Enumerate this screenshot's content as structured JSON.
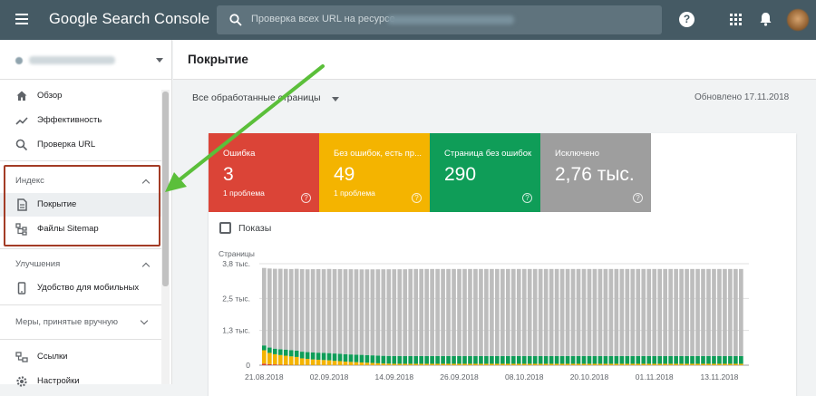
{
  "header": {
    "app_title": "Google Search Console",
    "search_placeholder": "Проверка всех URL на ресурсе",
    "help_glyph": "?"
  },
  "sidebar": {
    "items": [
      {
        "label": "Обзор",
        "icon": "home-icon"
      },
      {
        "label": "Эффективность",
        "icon": "trending-up-icon"
      },
      {
        "label": "Проверка URL",
        "icon": "search-icon"
      }
    ],
    "index_section": {
      "title": "Индекс",
      "items": [
        {
          "label": "Покрытие",
          "icon": "coverage-icon",
          "active": true
        },
        {
          "label": "Файлы Sitemap",
          "icon": "sitemap-icon"
        }
      ]
    },
    "enhancements_section": {
      "title": "Улучшения",
      "items": [
        {
          "label": "Удобство для мобильных",
          "icon": "phone-icon"
        }
      ]
    },
    "manual_section": {
      "title": "Меры, принятые вручную"
    },
    "bottom_items": [
      {
        "label": "Ссылки",
        "icon": "links-icon"
      },
      {
        "label": "Настройки",
        "icon": "settings-icon"
      }
    ]
  },
  "main": {
    "page_title": "Покрытие",
    "filter_label": "Все обработанные страницы",
    "updated": "Обновлено 17.11.2018",
    "impressions_label": "Показы",
    "tiles": [
      {
        "label": "Ошибка",
        "value": "3",
        "sub": "1 проблема",
        "color": "#db4437"
      },
      {
        "label": "Без ошибок, есть пр...",
        "value": "49",
        "sub": "1 проблема",
        "color": "#f4b400"
      },
      {
        "label": "Страница без ошибок",
        "value": "290",
        "sub": "",
        "color": "#0f9d58"
      },
      {
        "label": "Исключено",
        "value": "2,76 тыс.",
        "sub": "",
        "color": "#9e9e9e"
      }
    ]
  },
  "chart_data": {
    "type": "bar",
    "stacked": true,
    "ylabel": "Страницы",
    "y_ticks": [
      "0",
      "1,3 тыс.",
      "2,5 тыс.",
      "3,8 тыс."
    ],
    "ylim": [
      0,
      3800
    ],
    "x_tick_labels": [
      "21.08.2018",
      "02.09.2018",
      "14.09.2018",
      "26.09.2018",
      "08.10.2018",
      "20.10.2018",
      "01.11.2018",
      "13.11.2018"
    ],
    "x_start": "2018-08-21",
    "x_end": "2018-11-17",
    "series": [
      {
        "color": "#db4437",
        "first_values": [
          60,
          40,
          30,
          20,
          15,
          10,
          8,
          6,
          5,
          5,
          4,
          4,
          3
        ],
        "rest_value": 3
      },
      {
        "color": "#f4b400",
        "first_values": [
          500,
          420,
          380,
          360,
          340,
          320,
          300,
          250,
          230,
          210,
          200,
          190,
          180,
          160,
          150,
          130,
          120,
          110,
          100,
          90,
          80,
          70,
          60,
          55,
          50,
          50,
          49
        ],
        "rest_value": 49
      },
      {
        "color": "#0f9d58",
        "first_values": [
          180,
          200,
          210,
          220,
          230,
          230,
          240,
          250,
          255,
          260,
          265,
          270,
          270,
          275,
          275,
          280,
          280,
          282,
          284,
          285,
          286,
          287,
          288,
          289,
          289,
          290,
          290
        ],
        "rest_value": 290
      },
      {
        "color": "#bdbdbd",
        "first_values": [
          2900,
          2960,
          2990,
          3010,
          3020,
          3040,
          3060,
          3090,
          3100,
          3120,
          3130,
          3130,
          3150,
          3160,
          3170,
          3180,
          3190,
          3195,
          3200,
          3210,
          3220,
          3230,
          3240,
          3245,
          3250,
          3250,
          3250
        ],
        "rest_value": 3260
      }
    ],
    "grid": true
  }
}
